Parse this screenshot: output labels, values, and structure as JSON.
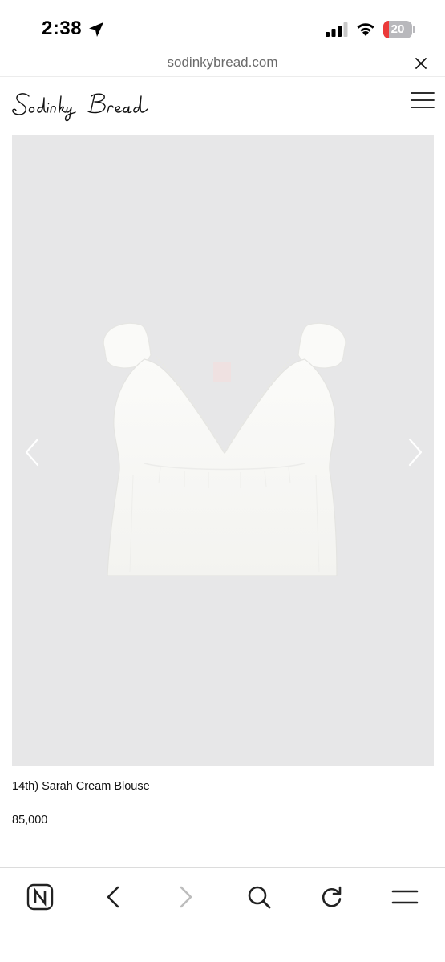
{
  "status_bar": {
    "time": "2:38",
    "battery_level": "20",
    "battery_fraction": 0.2,
    "location_icon": "location-arrow-icon",
    "signal_icon": "cellular-signal-icon",
    "wifi_icon": "wifi-icon"
  },
  "browser": {
    "url": "sodinkybread.com",
    "close_icon": "close-icon"
  },
  "site": {
    "logo_text": "Sodinky Bread",
    "menu_icon": "hamburger-menu-icon"
  },
  "product": {
    "name": "14th) Sarah Cream Blouse",
    "price": "85,000",
    "gallery_bg": "#e7e7e8",
    "prev_icon": "chevron-left-icon",
    "next_icon": "chevron-right-icon"
  },
  "toolbar": {
    "items": [
      "n-logo-icon",
      "back-arrow-icon",
      "forward-arrow-icon",
      "search-icon",
      "reload-icon",
      "menu-icon"
    ]
  }
}
